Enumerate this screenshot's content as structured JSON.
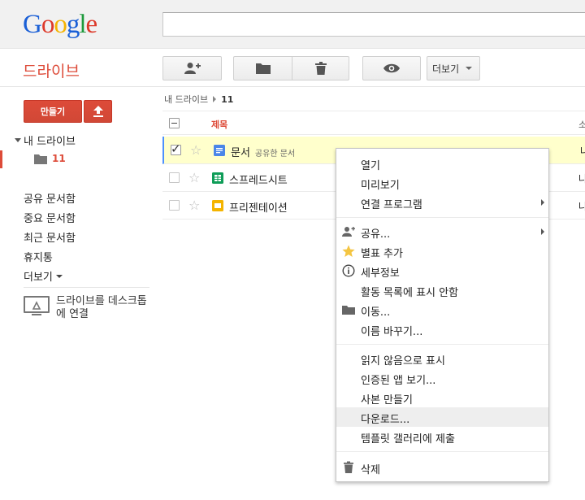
{
  "header": {
    "logo": [
      "G",
      "o",
      "o",
      "g",
      "l",
      "e"
    ],
    "logo_colors": [
      "#1a5fd6",
      "#dd3a2b",
      "#f5b300",
      "#1a5fd6",
      "#1e9a3c",
      "#dd3a2b"
    ],
    "search_value": ""
  },
  "toolbar": {
    "app_title": "드라이브",
    "more_label": "더보기"
  },
  "sidebar": {
    "create_label": "만들기",
    "my_drive": "내 드라이브",
    "folder": "11",
    "links": [
      "공유 문서함",
      "중요 문서함",
      "최근 문서함",
      "휴지통"
    ],
    "more": "더보기",
    "desktop_text": "드라이브를 데스크톱에 연결"
  },
  "breadcrumb": {
    "root": "내 드라이브",
    "current": "11"
  },
  "list": {
    "header_title": "제목",
    "header_right": "소",
    "rows": [
      {
        "name": "문서",
        "sub": "공유한 문서",
        "type": "doc-icon",
        "selected": true,
        "right": "나"
      },
      {
        "name": "스프레드시트",
        "sub": "",
        "type": "sheet-icon",
        "selected": false,
        "right": "나"
      },
      {
        "name": "프리젠테이션",
        "sub": "",
        "type": "slides-icon",
        "selected": false,
        "right": "나"
      }
    ]
  },
  "context_menu": {
    "items": [
      {
        "label": "열기"
      },
      {
        "label": "미리보기"
      },
      {
        "label": "연결 프로그램"
      },
      {
        "label": "공유..."
      },
      {
        "label": "별표 추가"
      },
      {
        "label": "세부정보"
      },
      {
        "label": "활동 목록에 표시 안함"
      },
      {
        "label": "이동..."
      },
      {
        "label": "이름 바꾸기..."
      },
      {
        "label": "읽지 않음으로 표시"
      },
      {
        "label": "인증된 앱 보기..."
      },
      {
        "label": "사본 만들기"
      },
      {
        "label": "다운로드..."
      },
      {
        "label": "템플릿 갤러리에 제출"
      },
      {
        "label": "삭제"
      }
    ]
  },
  "colors": {
    "accent": "#dd4b39",
    "selected_row": "#ffffcc",
    "doc": "#4a86e8",
    "sheet": "#0f9d58",
    "slides": "#f4b400"
  }
}
